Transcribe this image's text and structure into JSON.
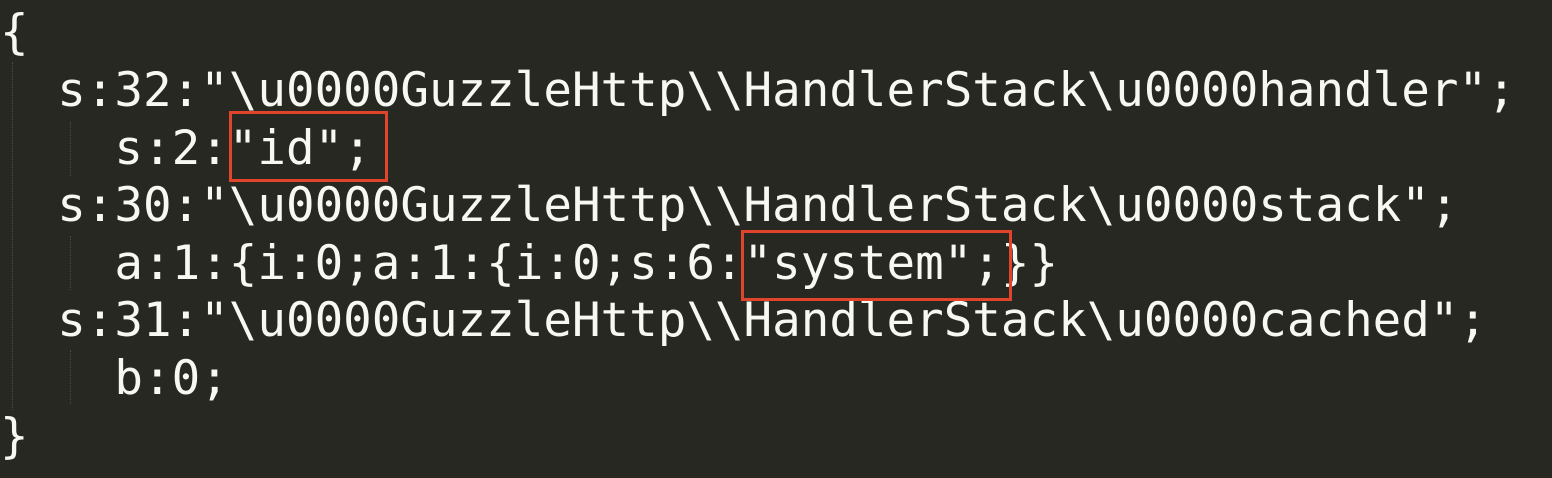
{
  "editor": {
    "theme_background": "#272822",
    "text_color": "#f8f8f2",
    "highlight_color": "#e0452c",
    "lines": [
      {
        "id": "line-1",
        "text": "{"
      },
      {
        "id": "line-2",
        "text": "  s:32:\"\\u0000GuzzleHttp\\\\HandlerStack\\u0000handler\";"
      },
      {
        "id": "line-3",
        "text": "    s:2:\"id\";"
      },
      {
        "id": "line-4",
        "text": "  s:30:\"\\u0000GuzzleHttp\\\\HandlerStack\\u0000stack\";"
      },
      {
        "id": "line-5",
        "text": "    a:1:{i:0;a:1:{i:0;s:6:\"system\";}}"
      },
      {
        "id": "line-6",
        "text": "  s:31:\"\\u0000GuzzleHttp\\\\HandlerStack\\u0000cached\";"
      },
      {
        "id": "line-7",
        "text": "    b:0;"
      },
      {
        "id": "line-8",
        "text": "}"
      }
    ],
    "highlights": [
      {
        "label": "id-value-highlight",
        "text": "\"id\";"
      },
      {
        "label": "system-value-highlight",
        "text": "\"system\";"
      }
    ]
  }
}
